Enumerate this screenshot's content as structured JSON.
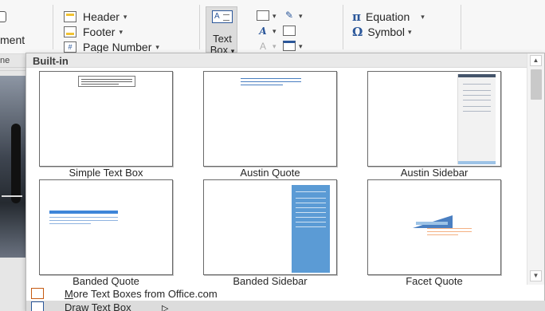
{
  "ribbon": {
    "left_fragment": "ment",
    "header_footer": [
      {
        "label": "Header",
        "icon": "header-icon"
      },
      {
        "label": "Footer",
        "icon": "footer-icon"
      },
      {
        "label": "Page Number",
        "icon": "page-number-icon"
      }
    ],
    "text_group": {
      "text_box_line1": "Text",
      "text_box_line2": "Box",
      "text_box_caret": "▾",
      "caret": "▾"
    },
    "symbols": [
      {
        "glyph": "π",
        "label": "Equation",
        "caret": "▾"
      },
      {
        "glyph": "Ω",
        "label": "Symbol",
        "caret": "▾"
      }
    ]
  },
  "doc_fragment": {
    "text": "ne"
  },
  "gallery": {
    "section_title": "Built-in",
    "thumbnails": [
      {
        "caption": "Simple Text Box"
      },
      {
        "caption": "Austin Quote"
      },
      {
        "caption": "Austin Sidebar"
      },
      {
        "caption": "Banded Quote"
      },
      {
        "caption": "Banded Sidebar"
      },
      {
        "caption": "Facet Quote"
      }
    ],
    "scroll_up": "▲",
    "scroll_down": "▼"
  },
  "menu": {
    "more_access": "M",
    "more_rest": "ore Text Boxes from Office.com",
    "draw_access": "D",
    "draw_rest": "raw Text Box",
    "draw_cursor": "▷"
  },
  "colors": {
    "accent": "#2b579a",
    "highlight": "#dcdcdc"
  }
}
